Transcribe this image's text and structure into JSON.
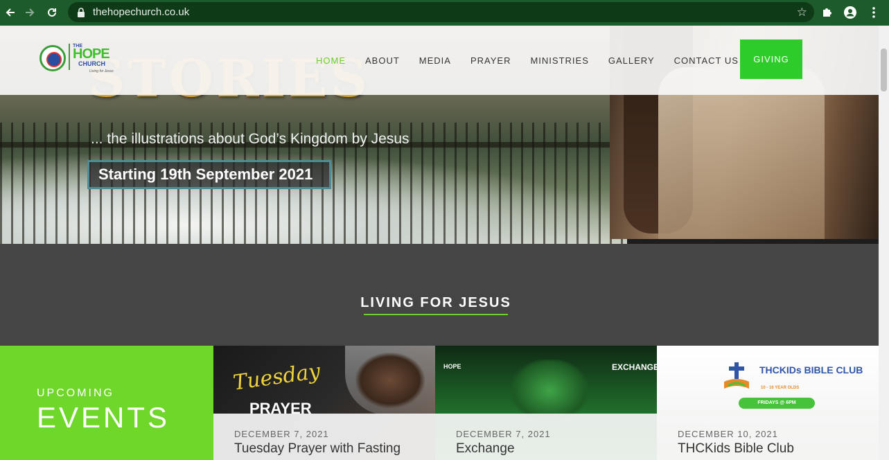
{
  "browser": {
    "url": "thehopechurch.co.uk"
  },
  "logo": {
    "the": "THE",
    "hope": "HOPE",
    "church": "CHURCH",
    "tagline": "Living for Jesus"
  },
  "nav": {
    "items": [
      {
        "label": "HOME",
        "active": true
      },
      {
        "label": "ABOUT"
      },
      {
        "label": "MEDIA"
      },
      {
        "label": "PRAYER"
      },
      {
        "label": "MINISTRIES"
      },
      {
        "label": "GALLERY"
      },
      {
        "label": "CONTACT US"
      }
    ],
    "giving_label": "GIVING"
  },
  "hero": {
    "title": "STORIES",
    "subtitle": "... the illustrations about God’s Kingdom by Jesus",
    "date_badge": "Starting 19th September 2021"
  },
  "section": {
    "heading": "LIVING FOR JESUS",
    "accent_color": "#6dd12c"
  },
  "events": {
    "label_small": "UPCOMING",
    "label_big": "EVENTS",
    "cards": [
      {
        "date": "DECEMBER 7, 2021",
        "title": "Tuesday Prayer with Fasting",
        "image_text_1": "Tuesday",
        "image_text_2": "PRAYER"
      },
      {
        "date": "DECEMBER 7, 2021",
        "title": "Exchange",
        "image_text_1": "HOPE",
        "image_text_2": "EXCHANGE"
      },
      {
        "date": "DECEMBER 10, 2021",
        "title": "THCKids Bible Club",
        "image_text_1": "THCKIDs BIBLE CLUB",
        "image_text_2": "10 - 16 YEAR OLDS",
        "image_text_3": "FRIDAYS @ 6PM"
      }
    ]
  },
  "colors": {
    "browser_chrome": "#1e5b2b",
    "nav_active": "#6dcd2c",
    "giving_button": "#2ecc2a",
    "upcoming_panel": "#6fd62a",
    "dark_section": "#454545"
  }
}
